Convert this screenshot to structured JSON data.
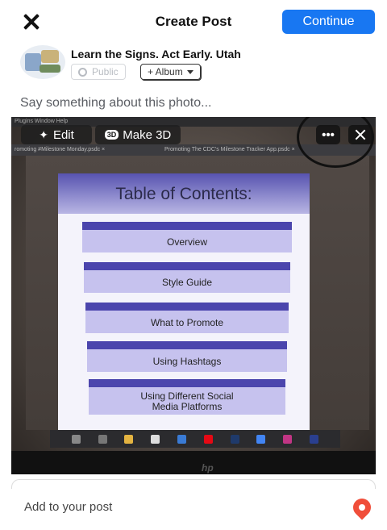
{
  "header": {
    "title": "Create Post",
    "continue_label": "Continue",
    "close_icon": "close-icon"
  },
  "profile": {
    "page_name": "Learn the Signs. Act Early. Utah",
    "privacy_label": "Public",
    "album_label": "+ Album"
  },
  "composer": {
    "placeholder": "Say something about this photo..."
  },
  "photo_toolbar": {
    "edit_label": "Edit",
    "make3d_badge": "3D",
    "make3d_label": "Make 3D",
    "more_label": "•••"
  },
  "photo": {
    "menubar_text": "Plugins  Window  Help",
    "tab_1": "romoting #Milestone Monday.psdc  ×",
    "tab_2": "Promoting The CDC's Milestone Tracker App.psdc  ×",
    "toc_title": "Table of Contents:",
    "toc_items": [
      "Overview",
      "Style Guide",
      "What to Promote",
      "Using Hashtags",
      "Using Different Social Media Platforms"
    ],
    "laptop_brand": "hp"
  },
  "footer": {
    "add_label": "Add to your post"
  },
  "colors": {
    "accent": "#1877f2",
    "toc_stripe": "#4b45ad",
    "toc_item": "#c6c2ee",
    "location_pin": "#f04e3a"
  }
}
